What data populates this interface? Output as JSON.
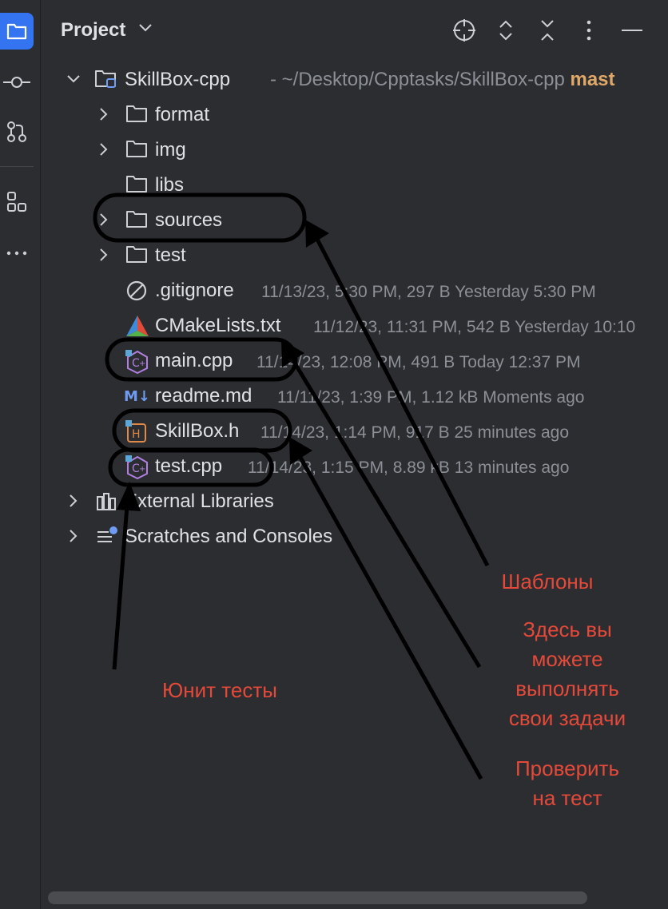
{
  "sidebar": {
    "icons": [
      "project-icon",
      "commit-icon",
      "pull-request-icon",
      "structure-icon",
      "more-icon"
    ]
  },
  "header": {
    "title": "Project"
  },
  "tree": {
    "root": {
      "name": "SkillBox-cpp",
      "path": "- ~/Desktop/Cpptasks/SkillBox-cpp",
      "branch": "mast"
    },
    "folders": [
      {
        "name": "format"
      },
      {
        "name": "img"
      },
      {
        "name": "libs"
      },
      {
        "name": "sources"
      },
      {
        "name": "test"
      }
    ],
    "files": [
      {
        "name": ".gitignore",
        "meta": "11/13/23, 5:30 PM, 297 B Yesterday 5:30 PM"
      },
      {
        "name": "CMakeLists.txt",
        "meta": "11/12/23, 11:31 PM, 542 B Yesterday 10:10"
      },
      {
        "name": "main.cpp",
        "meta": "11/14/23, 12:08 PM, 491 B Today 12:37 PM"
      },
      {
        "name": "readme.md",
        "meta": "11/11/23, 1:39 PM, 1.12 kB Moments ago"
      },
      {
        "name": "SkillBox.h",
        "meta": "11/14/23, 1:14 PM, 917 B 25 minutes ago"
      },
      {
        "name": "test.cpp",
        "meta": "11/14/23, 1:15 PM, 8.89 kB 13 minutes ago"
      }
    ],
    "external": "External Libraries",
    "scratches": "Scratches and Consoles"
  },
  "annotations": {
    "templates": "Шаблоны",
    "tasks_line1": "Здесь вы",
    "tasks_line2": "можете",
    "tasks_line3": "выполнять",
    "tasks_line4": "свои задачи",
    "check_line1": "Проверить",
    "check_line2": "на тест",
    "unit_tests": "Юнит тесты",
    "color": "#e5493a"
  }
}
